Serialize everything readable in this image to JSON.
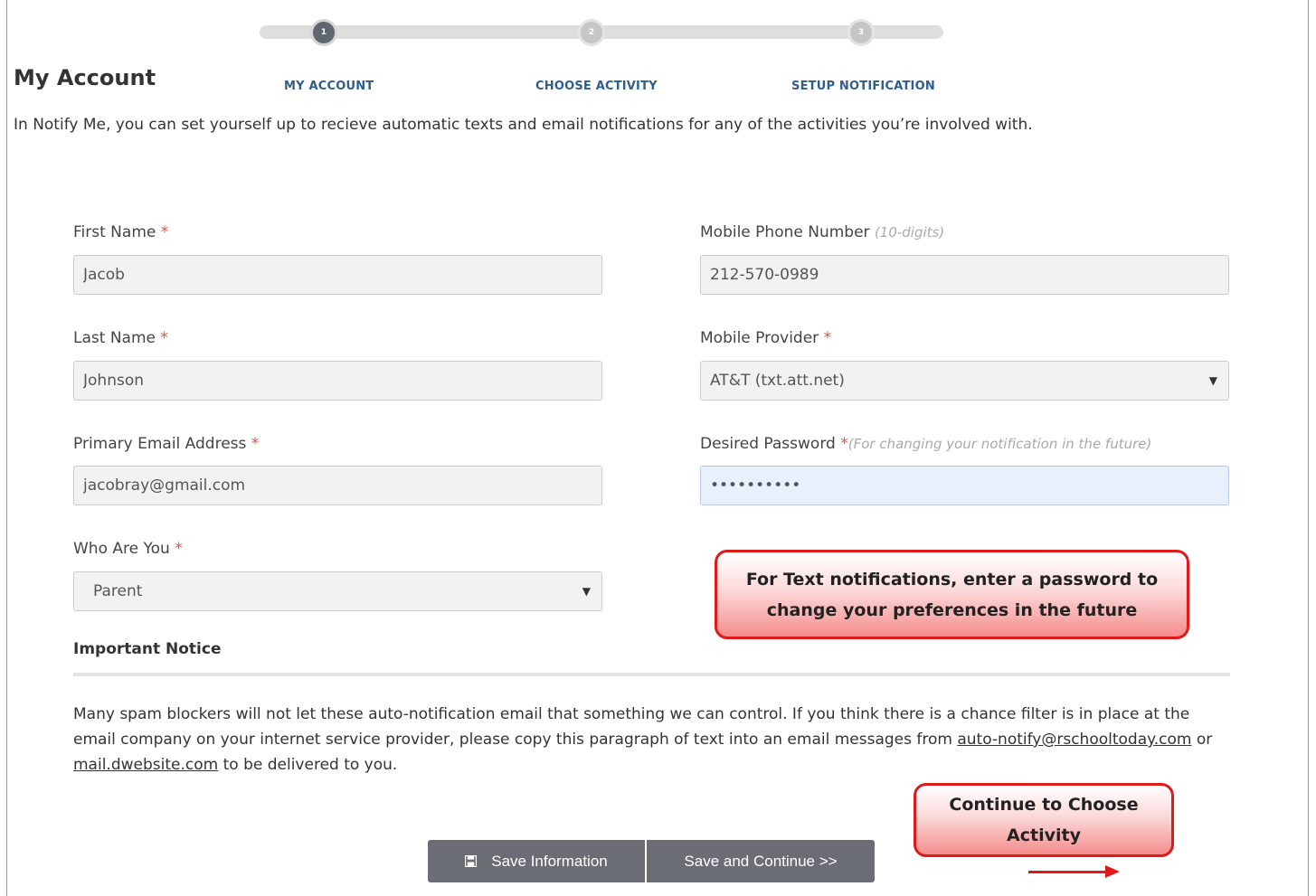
{
  "page": {
    "title": "My Account",
    "intro": "In Notify Me, you can set yourself up to recieve automatic texts and email notifications for any of the activities you’re involved with."
  },
  "stepper": {
    "steps": [
      {
        "number": "1",
        "label": "MY ACCOUNT",
        "state": "active"
      },
      {
        "number": "2",
        "label": "CHOOSE ACTIVITY",
        "state": "inactive"
      },
      {
        "number": "3",
        "label": "SETUP NOTIFICATION",
        "state": "inactive"
      }
    ]
  },
  "form": {
    "first_name": {
      "label": "First Name",
      "required": "*",
      "value": "Jacob"
    },
    "last_name": {
      "label": "Last Name",
      "required": "*",
      "value": "Johnson"
    },
    "email": {
      "label": "Primary Email Address",
      "required": "*",
      "value": "jacobray@gmail.com"
    },
    "who": {
      "label": "Who Are You",
      "required": "*",
      "value": "Parent"
    },
    "phone": {
      "label": "Mobile Phone Number",
      "hint": "(10-digits)",
      "value": "212-570-0989"
    },
    "provider": {
      "label": "Mobile Provider",
      "required": "*",
      "value": "AT&T (txt.att.net)"
    },
    "password": {
      "label": "Desired Password",
      "required": "*",
      "hint": "(For changing your notification in the future)",
      "value": "••••••••••"
    }
  },
  "notice": {
    "title": "Important Notice",
    "text_1": "Many spam blockers will not let these auto-notification email that something we can control. If you think there is a chance filter is in place at the email company on your internet service provider, please copy this paragraph of text into an email messages from ",
    "link_1": "auto-notify@rschooltoday.com",
    "text_2": " or ",
    "link_2": "mail.dwebsite.com",
    "text_3": " to be delivered to you."
  },
  "callouts": {
    "password_tip": "For Text notifications, enter a password to change your preferences in the future",
    "continue_tip": "Continue to Choose Activity"
  },
  "buttons": {
    "save": "Save Information",
    "continue": "Save and Continue >>"
  },
  "colors": {
    "accent_blue": "#2f5d8c",
    "required_red": "#d9534f",
    "callout_red": "#e0191b",
    "button_gray": "#6a6e74"
  }
}
